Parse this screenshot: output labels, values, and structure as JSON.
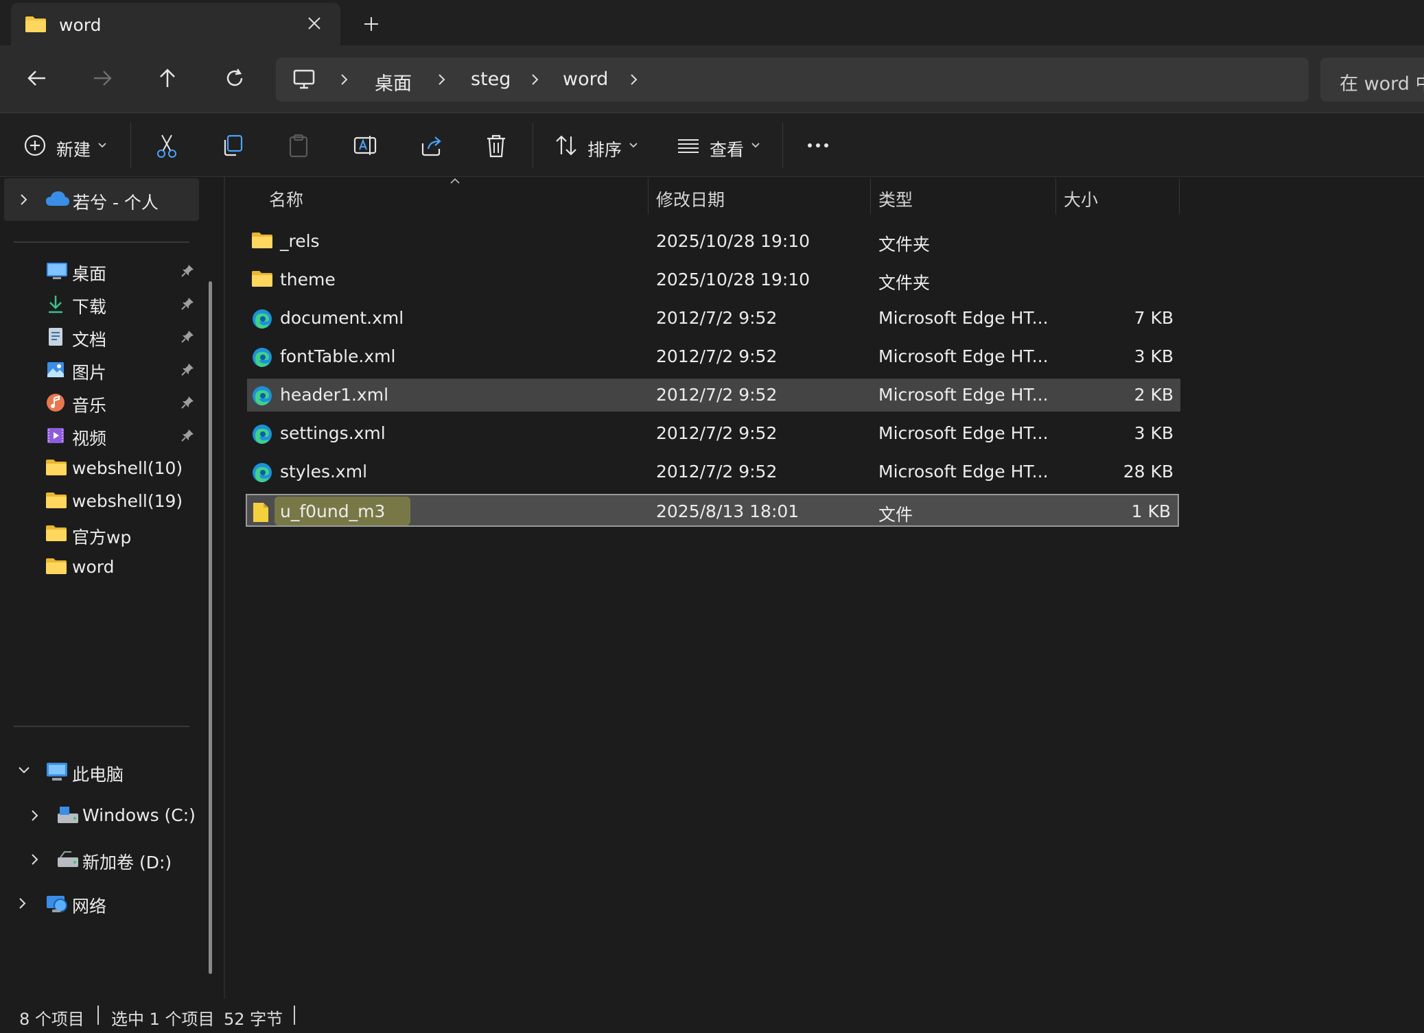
{
  "tab": {
    "title": "word",
    "icon": "folder-icon"
  },
  "breadcrumb": {
    "items": [
      "桌面",
      "steg",
      "word"
    ]
  },
  "search": {
    "placeholder": "在 word 中"
  },
  "toolbar": {
    "new_label": "新建",
    "sort_label": "排序",
    "view_label": "查看"
  },
  "sidebar": {
    "cloud": "若兮 - 个人",
    "quick_access": [
      {
        "label": "桌面",
        "icon": "desktop-icon",
        "pinned": true
      },
      {
        "label": "下载",
        "icon": "download-icon",
        "pinned": true
      },
      {
        "label": "文档",
        "icon": "documents-icon",
        "pinned": true
      },
      {
        "label": "图片",
        "icon": "pictures-icon",
        "pinned": true
      },
      {
        "label": "音乐",
        "icon": "music-icon",
        "pinned": true
      },
      {
        "label": "视频",
        "icon": "videos-icon",
        "pinned": true
      },
      {
        "label": "webshell(10)",
        "icon": "folder-icon",
        "pinned": false
      },
      {
        "label": "webshell(19)",
        "icon": "folder-icon",
        "pinned": false
      },
      {
        "label": "官方wp",
        "icon": "folder-icon",
        "pinned": false
      },
      {
        "label": "word",
        "icon": "folder-icon",
        "pinned": false
      }
    ],
    "this_pc": "此电脑",
    "drives": [
      "Windows (C:)",
      "新加卷 (D:)"
    ],
    "network": "网络"
  },
  "columns": {
    "name": "名称",
    "date": "修改日期",
    "type": "类型",
    "size": "大小"
  },
  "files": [
    {
      "name": "_rels",
      "date": "2025/10/28 19:10",
      "type": "文件夹",
      "size": "",
      "icon": "folder-icon"
    },
    {
      "name": "theme",
      "date": "2025/10/28 19:10",
      "type": "文件夹",
      "size": "",
      "icon": "folder-icon"
    },
    {
      "name": "document.xml",
      "date": "2012/7/2 9:52",
      "type": "Microsoft Edge HT...",
      "size": "7 KB",
      "icon": "edge-icon"
    },
    {
      "name": "fontTable.xml",
      "date": "2012/7/2 9:52",
      "type": "Microsoft Edge HT...",
      "size": "3 KB",
      "icon": "edge-icon"
    },
    {
      "name": "header1.xml",
      "date": "2012/7/2 9:52",
      "type": "Microsoft Edge HT...",
      "size": "2 KB",
      "icon": "edge-icon"
    },
    {
      "name": "settings.xml",
      "date": "2012/7/2 9:52",
      "type": "Microsoft Edge HT...",
      "size": "3 KB",
      "icon": "edge-icon"
    },
    {
      "name": "styles.xml",
      "date": "2012/7/2 9:52",
      "type": "Microsoft Edge HT...",
      "size": "28 KB",
      "icon": "edge-icon"
    },
    {
      "name": "u_f0und_m3",
      "date": "2025/8/13 18:01",
      "type": "文件",
      "size": "1 KB",
      "icon": "file-icon"
    }
  ],
  "status": {
    "count": "8 个项目",
    "selected": "选中 1 个项目",
    "bytes": "52 字节"
  },
  "colors": {
    "background": "#1c1c1c",
    "selected_row": "#4d4d4d",
    "folder": "#f4c542",
    "edge": "#1e90d8",
    "highlight": "#c8c83c"
  }
}
